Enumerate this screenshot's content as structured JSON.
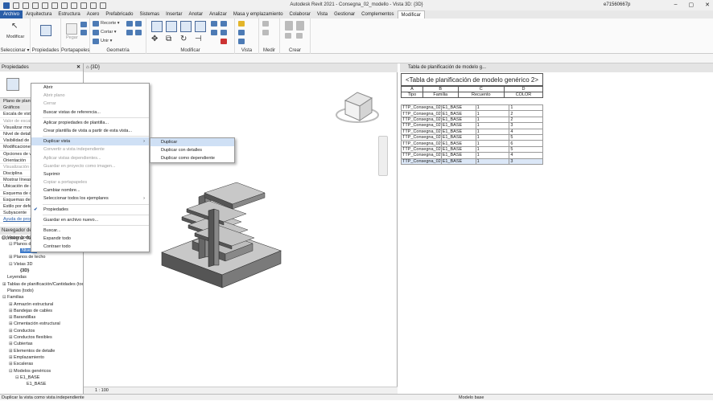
{
  "app": {
    "title": "Autodesk Revit 2021 - Consegna_02_modello - Vista 3D: {3D}",
    "user": "e71560667p"
  },
  "tabs": [
    "Archivo",
    "Arquitectura",
    "Estructura",
    "Acero",
    "Prefabricado",
    "Sistemas",
    "Insertar",
    "Anotar",
    "Analizar",
    "Masa y emplazamiento",
    "Colaborar",
    "Vista",
    "Gestionar",
    "Complementos",
    "Modificar"
  ],
  "ribbon": {
    "modify_label": "Modificar",
    "select_label": "Seleccionar ▾",
    "props_label": "Propiedades",
    "clipboard_label": "Portapapeles",
    "paste_label": "Pegar",
    "cut_label": "Recorte ▾",
    "trim_label": "Cortar ▾",
    "join_label": "Unir ▾",
    "geometry_label": "Geometría",
    "modify_group_label": "Modificar",
    "view_label": "Vista",
    "measure_label": "Medir",
    "create_label": "Crear"
  },
  "properties_panel": {
    "title": "Propiedades",
    "rows": [
      "Plano de planta",
      "Gráficos",
      "Escala de vista",
      "Valor de escala",
      "Visualizar modelo",
      "Nivel de detalle",
      "Visibilidad de piezas",
      "Modificaciones de visibilidad",
      "Opciones de visualización",
      "Orientación",
      "Visualización de uniones",
      "Disciplina",
      "Mostrar líneas ocultas",
      "Ubicación de color",
      "Esquema de color",
      "Esquemas de color",
      "Estilo por defecto",
      "Subyacente"
    ],
    "grey_rows": [
      3,
      10
    ],
    "help_link": "Ayuda de propiedades"
  },
  "project_browser": {
    "title": "Navegador de proyectos - Consegna_02_modello",
    "items": [
      {
        "indent": 0,
        "exp": "⊟",
        "label": "Vistas (todas)"
      },
      {
        "indent": 1,
        "exp": "⊟",
        "label": "Planos de planta"
      },
      {
        "indent": 2,
        "exp": "",
        "label": "Nivel 1",
        "selected": true
      },
      {
        "indent": 1,
        "exp": "⊞",
        "label": "Planos de techo"
      },
      {
        "indent": 1,
        "exp": "⊟",
        "label": "Vistas 3D"
      },
      {
        "indent": 2,
        "exp": "",
        "label": "{3D}",
        "bold": true
      },
      {
        "indent": 0,
        "exp": "",
        "label": "Leyendas"
      },
      {
        "indent": 0,
        "exp": "⊞",
        "label": "Tablas de planificación/Cantidades (todas)"
      },
      {
        "indent": 0,
        "exp": "",
        "label": "Planos (todo)"
      },
      {
        "indent": 0,
        "exp": "⊟",
        "label": "Familias"
      },
      {
        "indent": 1,
        "exp": "⊞",
        "label": "Armazón estructural"
      },
      {
        "indent": 1,
        "exp": "⊞",
        "label": "Bandejas de cables"
      },
      {
        "indent": 1,
        "exp": "⊞",
        "label": "Barandillas"
      },
      {
        "indent": 1,
        "exp": "⊞",
        "label": "Cimentación estructural"
      },
      {
        "indent": 1,
        "exp": "⊞",
        "label": "Conductos"
      },
      {
        "indent": 1,
        "exp": "⊞",
        "label": "Conductos flexibles"
      },
      {
        "indent": 1,
        "exp": "⊞",
        "label": "Cubiertas"
      },
      {
        "indent": 1,
        "exp": "⊞",
        "label": "Elementos de detalle"
      },
      {
        "indent": 1,
        "exp": "⊞",
        "label": "Emplazamiento"
      },
      {
        "indent": 1,
        "exp": "⊞",
        "label": "Escaleras"
      },
      {
        "indent": 1,
        "exp": "⊟",
        "label": "Modelos genéricos"
      },
      {
        "indent": 2,
        "exp": "⊟",
        "label": "E1_BASE"
      },
      {
        "indent": 3,
        "exp": "",
        "label": "E1_BASE"
      }
    ]
  },
  "view3d": {
    "tab_label": "{3D}",
    "scale": "1 : 100"
  },
  "context_menu": {
    "items": [
      {
        "label": "Abrir",
        "state": "normal"
      },
      {
        "label": "Abrir plano",
        "state": "grey"
      },
      {
        "label": "Cerrar",
        "state": "grey"
      },
      {
        "label": "Buscar vistas de referencia...",
        "state": "normal"
      },
      {
        "sep": true
      },
      {
        "label": "Aplicar propiedades de plantilla...",
        "state": "normal"
      },
      {
        "label": "Crear plantilla de vista a partir de esta vista...",
        "state": "normal"
      },
      {
        "sep": true
      },
      {
        "label": "Duplicar vista",
        "state": "hl",
        "arrow": true
      },
      {
        "label": "Convertir a vista independiente",
        "state": "grey"
      },
      {
        "label": "Aplicar vistas dependientes...",
        "state": "grey"
      },
      {
        "label": "Guardar en proyecto como imagen...",
        "state": "grey"
      },
      {
        "label": "Suprimir",
        "state": "normal"
      },
      {
        "label": "Copiar a portapapeles",
        "state": "grey"
      },
      {
        "label": "Cambiar nombre...",
        "state": "normal"
      },
      {
        "label": "Seleccionar todos los ejemplares",
        "state": "normal",
        "arrow": true
      },
      {
        "sep": true
      },
      {
        "label": "Propiedades",
        "state": "normal",
        "check": true
      },
      {
        "sep": true
      },
      {
        "label": "Guardar en archivo nuevo...",
        "state": "normal"
      },
      {
        "sep": true
      },
      {
        "label": "Buscar...",
        "state": "normal"
      },
      {
        "label": "Expandir todo",
        "state": "normal"
      },
      {
        "label": "Contraer todo",
        "state": "normal"
      }
    ]
  },
  "submenu": {
    "items": [
      "Duplicar",
      "Duplicar con detalles",
      "Duplicar como dependiente"
    ]
  },
  "schedule": {
    "tab_label": "Tabla de planificación de modelo g...",
    "title": "<Tabla de planificación de modelo genérico 2>",
    "letters": [
      "A",
      "B",
      "C",
      "D"
    ],
    "headers": [
      "Tipo",
      "Familia",
      "Recuento",
      "COLOR"
    ],
    "rows": [
      [
        "TTP_Consegna_02",
        "E1_BASE",
        "1",
        "1"
      ],
      [
        "TTP_Consegna_02",
        "E1_BASE",
        "1",
        "2"
      ],
      [
        "TTP_Consegna_02",
        "E1_BASE",
        "1",
        "2"
      ],
      [
        "TTP_Consegna_02",
        "E1_BASE",
        "1",
        "3"
      ],
      [
        "TTP_Consegna_02",
        "E1_BASE",
        "1",
        "4"
      ],
      [
        "TTP_Consegna_02",
        "E1_BASE",
        "1",
        "5"
      ],
      [
        "TTP_Consegna_02",
        "E1_BASE",
        "1",
        "6"
      ],
      [
        "TTP_Consegna_02",
        "E1_BASE",
        "1",
        "5"
      ],
      [
        "TTP_Consegna_02",
        "E1_BASE",
        "1",
        "4"
      ],
      [
        "TTP_Consegna_02",
        "E1_BASE",
        "1",
        "3"
      ]
    ]
  },
  "status_bar": {
    "text": "Duplicar la vista como vista independiente",
    "model": "Modelo base"
  }
}
